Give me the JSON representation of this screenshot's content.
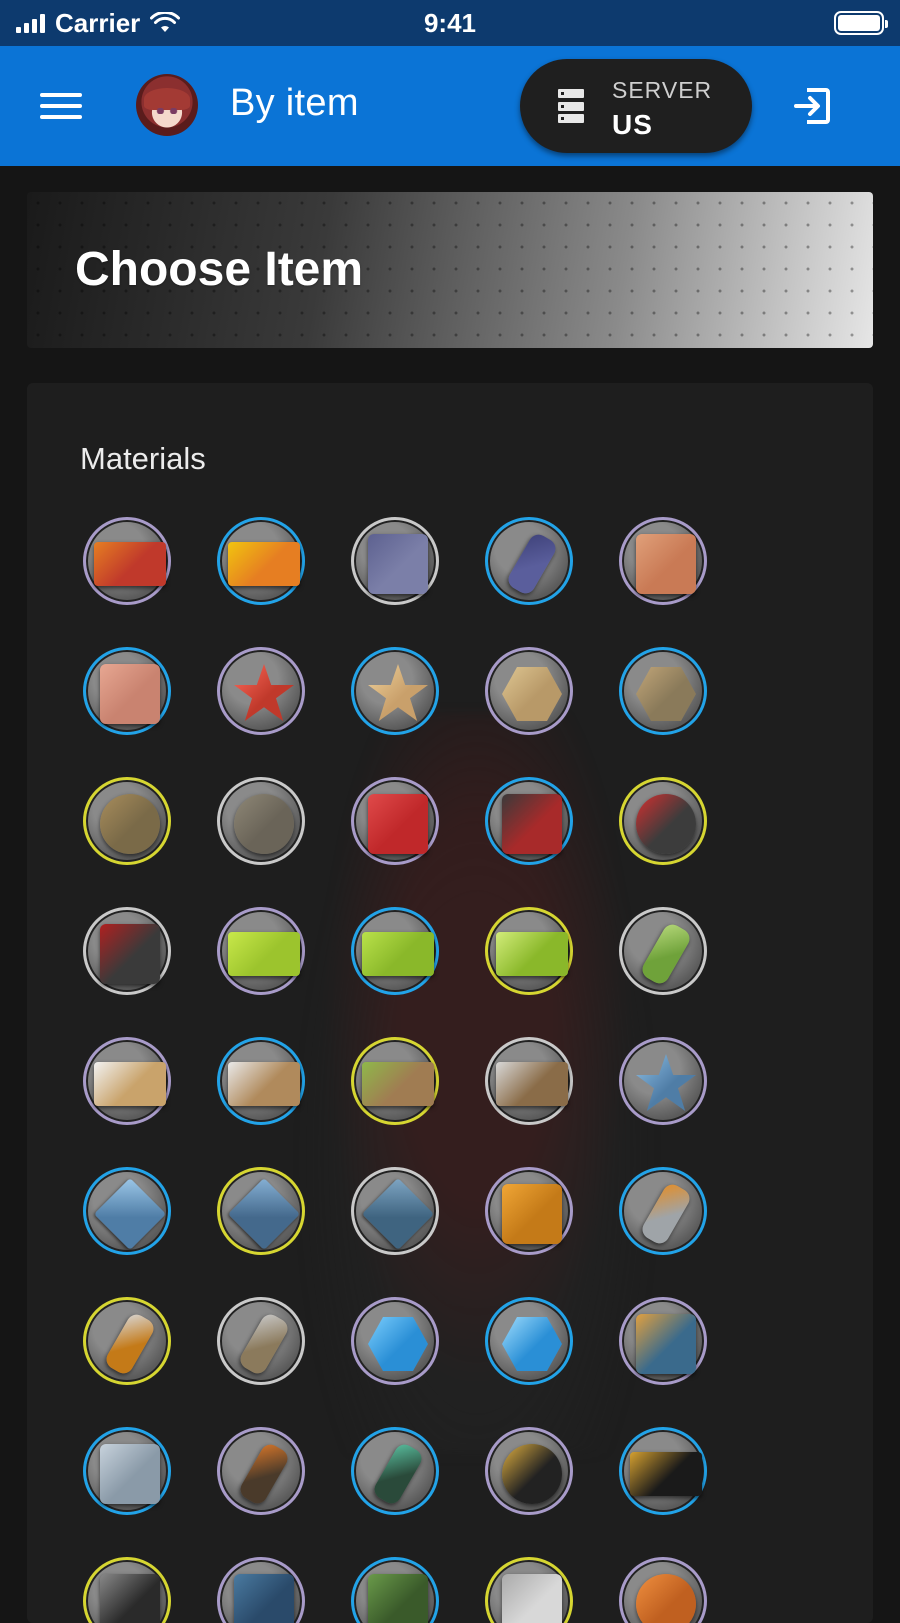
{
  "status_bar": {
    "carrier": "Carrier",
    "time": "9:41",
    "battery_level": 1.0
  },
  "app_bar": {
    "title": "By item",
    "server": {
      "label": "SERVER",
      "value": "US"
    },
    "icons": {
      "menu": "hamburger-menu-icon",
      "server": "server-icon",
      "logout": "logout-icon"
    }
  },
  "hero": {
    "title": "Choose Item"
  },
  "materials": {
    "title": "Materials",
    "rarity_colors": {
      "purple": "#a89bc9",
      "blue": "#22a3e8",
      "yellow": "#d6d631",
      "white": "#c9c9c9"
    },
    "items": [
      {
        "rarity": "purple",
        "shape": "flat",
        "color": "#c0392b",
        "accent": "#e67e22"
      },
      {
        "rarity": "blue",
        "shape": "flat",
        "color": "#e67e22",
        "accent": "#f1c40f"
      },
      {
        "rarity": "white",
        "shape": "square",
        "color": "#7b7fa8",
        "accent": "#5d6190"
      },
      {
        "rarity": "blue",
        "shape": "tall",
        "color": "#5a5e9c",
        "accent": "#3f427a"
      },
      {
        "rarity": "purple",
        "shape": "square",
        "color": "#c97a55",
        "accent": "#e0a07a"
      },
      {
        "rarity": "blue",
        "shape": "square",
        "color": "#c98370",
        "accent": "#e7a792"
      },
      {
        "rarity": "purple",
        "shape": "star",
        "color": "#c0392b",
        "accent": "#ff6b5b"
      },
      {
        "rarity": "blue",
        "shape": "star",
        "color": "#c9a06b",
        "accent": "#f0d39c"
      },
      {
        "rarity": "purple",
        "shape": "hex",
        "color": "#b89968",
        "accent": "#e0c894"
      },
      {
        "rarity": "blue",
        "shape": "hex",
        "color": "#8a7a5a",
        "accent": "#c4a87a"
      },
      {
        "rarity": "yellow",
        "shape": "round",
        "color": "#7a6a48",
        "accent": "#a88d5c"
      },
      {
        "rarity": "white",
        "shape": "round",
        "color": "#6a6458",
        "accent": "#8f8877"
      },
      {
        "rarity": "purple",
        "shape": "square",
        "color": "#c0282a",
        "accent": "#e04a4a"
      },
      {
        "rarity": "blue",
        "shape": "square",
        "color": "#a82a2a",
        "accent": "#3a3a3a"
      },
      {
        "rarity": "yellow",
        "shape": "round",
        "color": "#3c3c3c",
        "accent": "#d62f2f"
      },
      {
        "rarity": "white",
        "shape": "square",
        "color": "#3a3a3a",
        "accent": "#b02020"
      },
      {
        "rarity": "purple",
        "shape": "flat",
        "color": "#9cc42d",
        "accent": "#c8e84a"
      },
      {
        "rarity": "blue",
        "shape": "flat",
        "color": "#8ab82a",
        "accent": "#b9e14a"
      },
      {
        "rarity": "yellow",
        "shape": "flat",
        "color": "#8ab82a",
        "accent": "#d2ec7a"
      },
      {
        "rarity": "white",
        "shape": "tall",
        "color": "#6fa23a",
        "accent": "#b6d87a"
      },
      {
        "rarity": "purple",
        "shape": "flat",
        "color": "#c9a36b",
        "accent": "#f2f2f2"
      },
      {
        "rarity": "blue",
        "shape": "flat",
        "color": "#b08a5c",
        "accent": "#e9e9e9"
      },
      {
        "rarity": "yellow",
        "shape": "flat",
        "color": "#a07c52",
        "accent": "#8fb84a"
      },
      {
        "rarity": "white",
        "shape": "flat",
        "color": "#8a6c48",
        "accent": "#d8d8d8"
      },
      {
        "rarity": "purple",
        "shape": "star",
        "color": "#4f7da6",
        "accent": "#8fc0e6"
      },
      {
        "rarity": "blue",
        "shape": "diamond",
        "color": "#4f7da6",
        "accent": "#9cc7e8"
      },
      {
        "rarity": "yellow",
        "shape": "diamond",
        "color": "#44698c",
        "accent": "#86b0d4"
      },
      {
        "rarity": "white",
        "shape": "diamond",
        "color": "#3f6480",
        "accent": "#7fa6c4"
      },
      {
        "rarity": "purple",
        "shape": "square",
        "color": "#c47a18",
        "accent": "#f0a636"
      },
      {
        "rarity": "blue",
        "shape": "tall",
        "color": "#9fa4a8",
        "accent": "#e58d25"
      },
      {
        "rarity": "yellow",
        "shape": "tall",
        "color": "#c47a18",
        "accent": "#d8d8d8"
      },
      {
        "rarity": "white",
        "shape": "tall",
        "color": "#8b7a5c",
        "accent": "#c9c9c9"
      },
      {
        "rarity": "purple",
        "shape": "hex",
        "color": "#2a8fd6",
        "accent": "#7fd1ff"
      },
      {
        "rarity": "blue",
        "shape": "hex",
        "color": "#2a8fd6",
        "accent": "#a6e1ff"
      },
      {
        "rarity": "purple",
        "shape": "square",
        "color": "#3a6a8c",
        "accent": "#e0a040"
      },
      {
        "rarity": "blue",
        "shape": "square",
        "color": "#8a9aa8",
        "accent": "#c7d2dc"
      },
      {
        "rarity": "purple",
        "shape": "tall",
        "color": "#4a3a2a",
        "accent": "#d6762a"
      },
      {
        "rarity": "blue",
        "shape": "tall",
        "color": "#2a4a3a",
        "accent": "#5ac0a0"
      },
      {
        "rarity": "purple",
        "shape": "round",
        "color": "#222222",
        "accent": "#e0b040"
      },
      {
        "rarity": "blue",
        "shape": "flat",
        "color": "#1a1a1a",
        "accent": "#d4a030"
      },
      {
        "rarity": "yellow",
        "shape": "square",
        "color": "#2a2a2a",
        "accent": "#888888"
      },
      {
        "rarity": "purple",
        "shape": "square",
        "color": "#2a4a6a",
        "accent": "#4a7aa0"
      },
      {
        "rarity": "blue",
        "shape": "square",
        "color": "#3a5a2a",
        "accent": "#6a9a4a"
      },
      {
        "rarity": "yellow",
        "shape": "square",
        "color": "#d8d8d8",
        "accent": "#aaaaaa"
      },
      {
        "rarity": "purple",
        "shape": "round",
        "color": "#c06020",
        "accent": "#f09040"
      }
    ]
  }
}
